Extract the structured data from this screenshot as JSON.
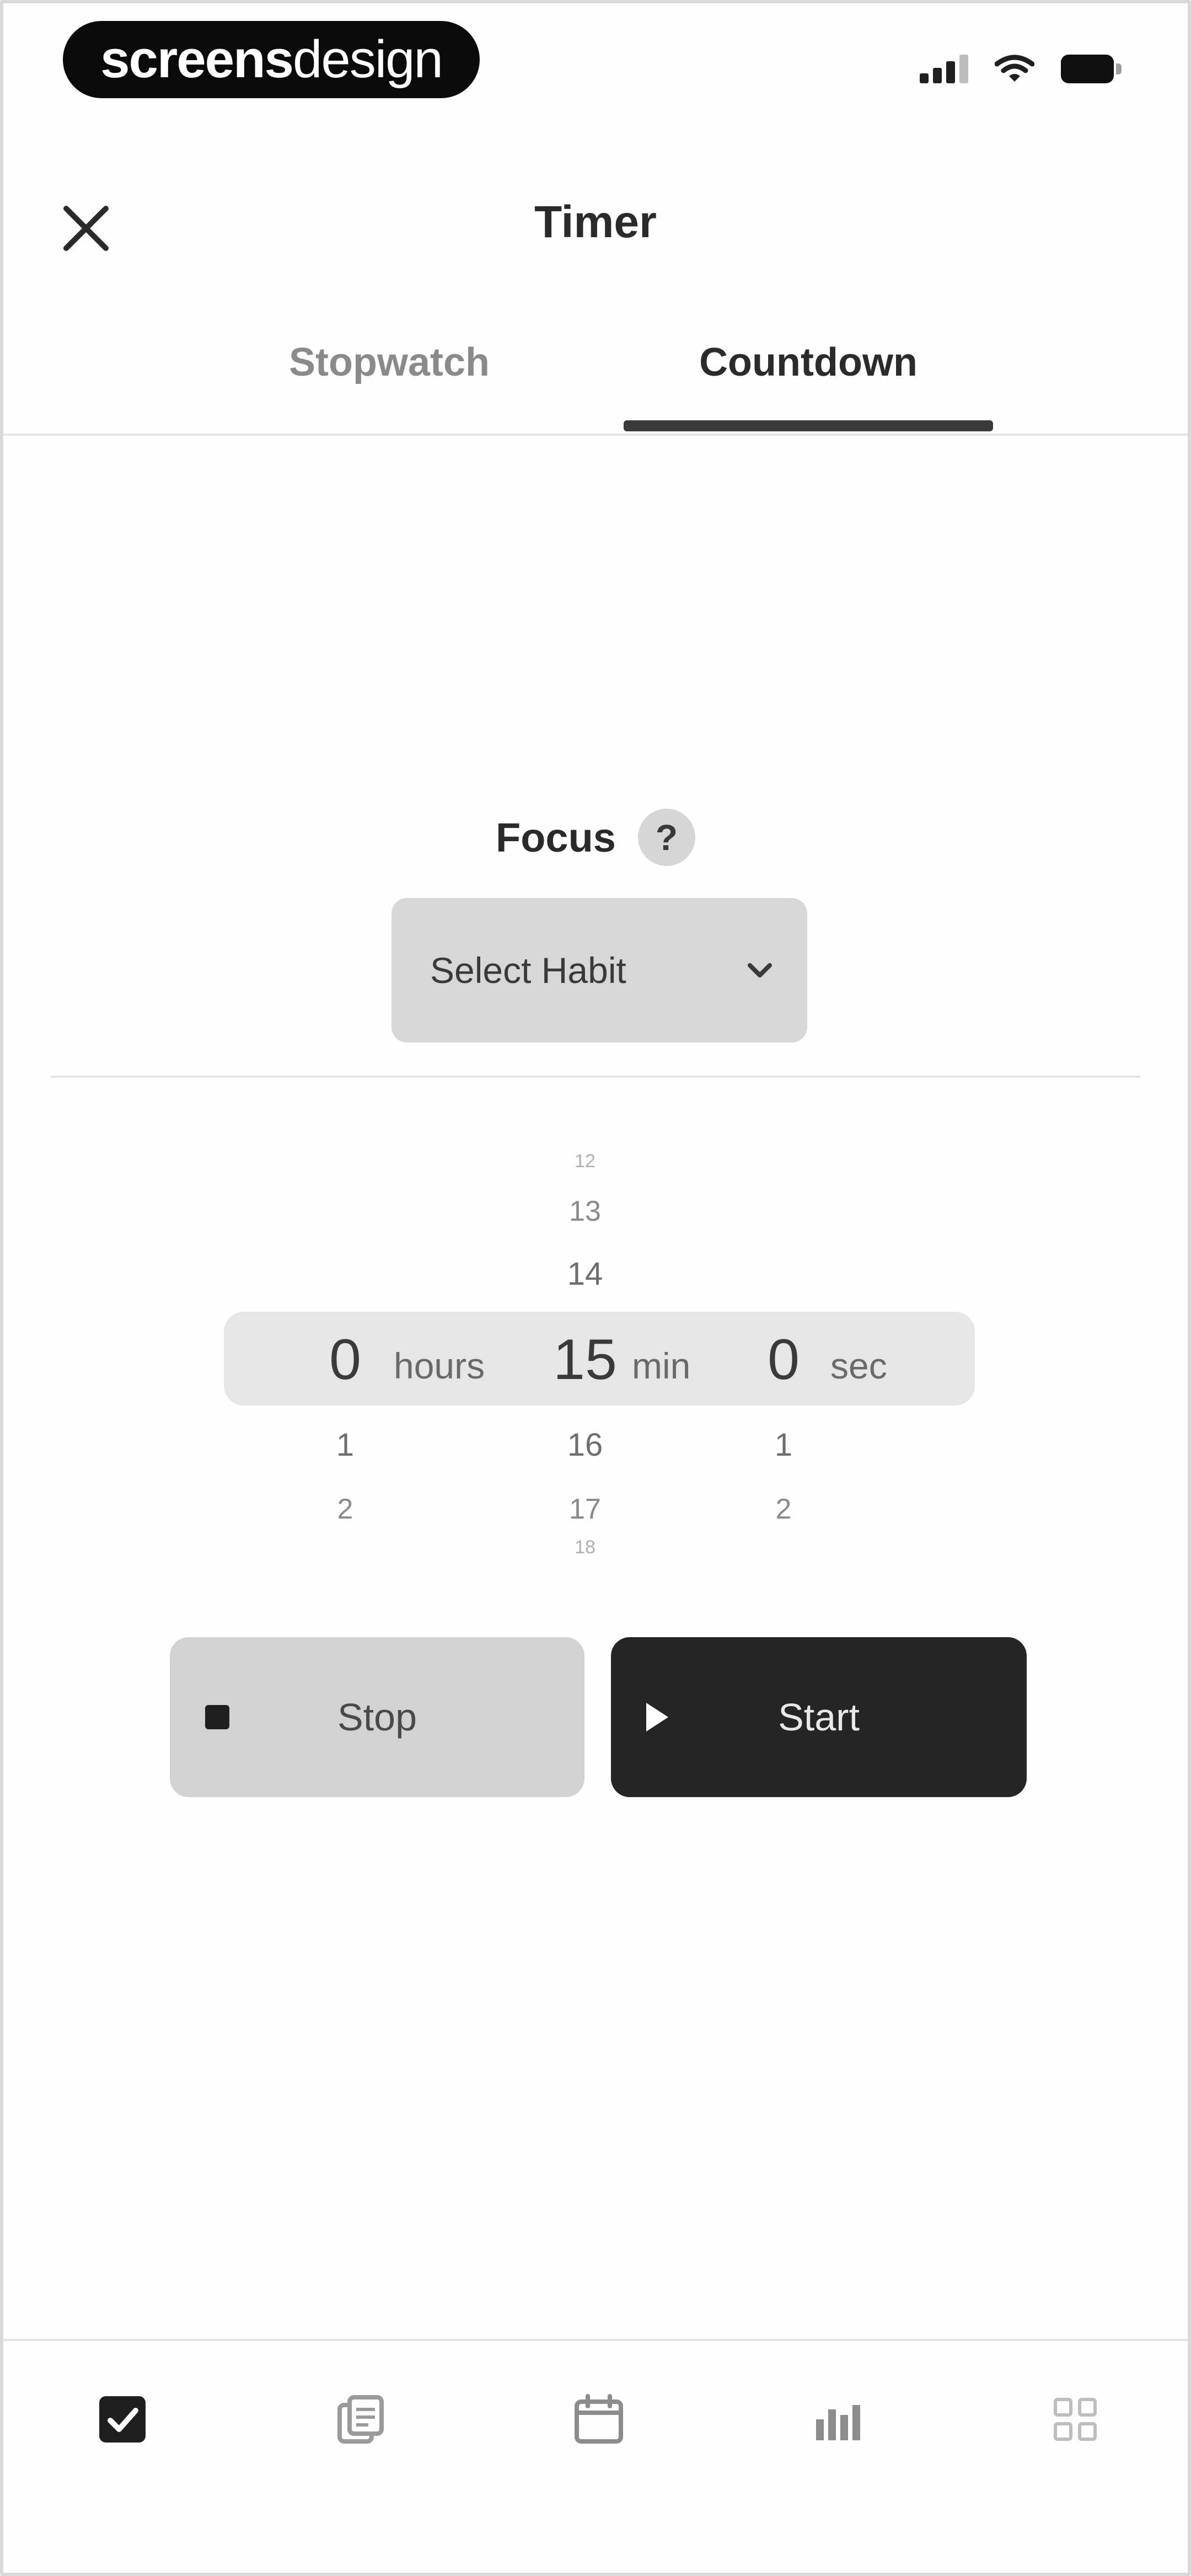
{
  "status_bar": {
    "brand_part1": "screens",
    "brand_part2": "design",
    "signal_icon": "signal-icon",
    "wifi_icon": "wifi-icon",
    "battery_icon": "battery-icon"
  },
  "header": {
    "title": "Timer",
    "close_icon": "close-icon"
  },
  "tabs": [
    {
      "label": "Stopwatch",
      "active": false
    },
    {
      "label": "Countdown",
      "active": true
    }
  ],
  "focus": {
    "label": "Focus",
    "help_glyph": "?",
    "select_placeholder": "Select Habit",
    "chevron_icon": "chevron-down-icon"
  },
  "picker": {
    "hours": {
      "values": [
        "0",
        "1",
        "2"
      ],
      "selected": "0",
      "unit": "hours"
    },
    "minutes": {
      "values": [
        "12",
        "13",
        "14",
        "15",
        "16",
        "17",
        "18"
      ],
      "selected": "15",
      "unit": "min"
    },
    "seconds": {
      "values": [
        "0",
        "1",
        "2"
      ],
      "selected": "0",
      "unit": "sec"
    }
  },
  "buttons": {
    "stop_label": "Stop",
    "start_label": "Start"
  },
  "bottom_nav": [
    {
      "icon": "checkbox-icon",
      "active": true
    },
    {
      "icon": "notes-icon",
      "active": false
    },
    {
      "icon": "calendar-icon",
      "active": false
    },
    {
      "icon": "stats-icon",
      "active": false
    },
    {
      "icon": "grid-icon",
      "active": false
    }
  ],
  "colors": {
    "accent": "#252525",
    "tab_indicator": "#3a3a3a",
    "surface": "#d7d7d7",
    "background": "#ffffff"
  }
}
